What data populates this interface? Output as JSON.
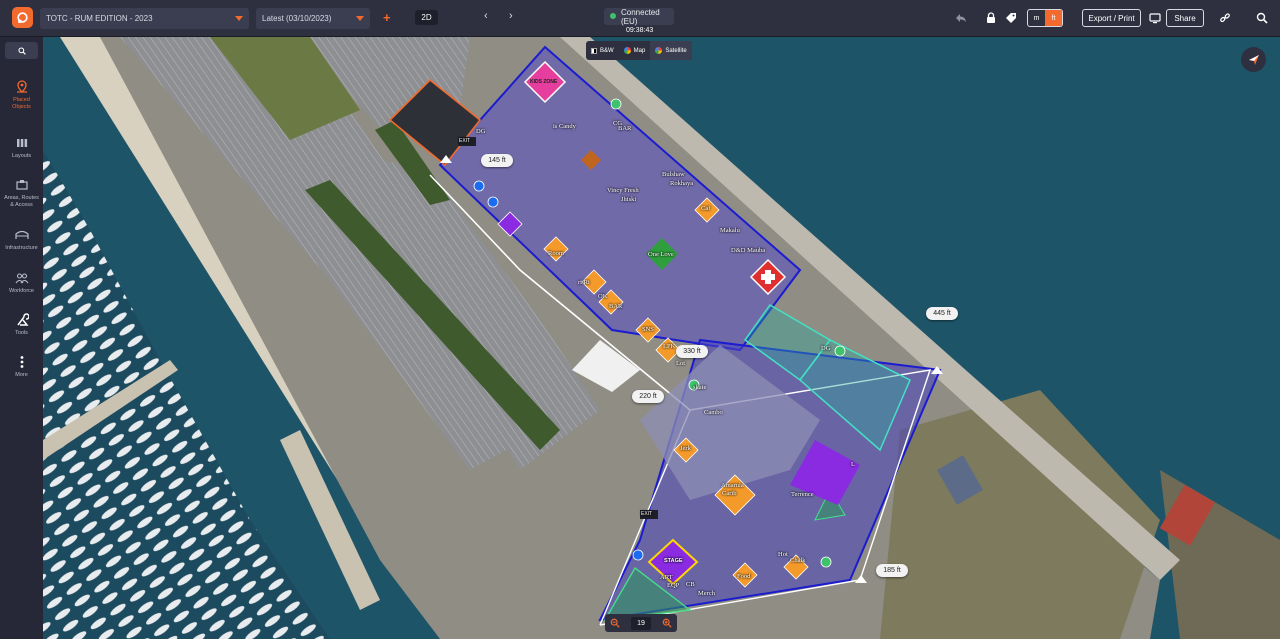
{
  "topbar": {
    "event_select": "TOTC - RUM EDITION - 2023",
    "version_select": "Latest (03/10/2023)",
    "view_mode": "2D",
    "connection_status": "Connected (EU)",
    "clock": "09:38:43",
    "unit_m": "m",
    "unit_ft": "ft",
    "unit_active": "ft",
    "export_label": "Export / Print",
    "share_label": "Share",
    "accent_color": "#f26a2e"
  },
  "sidebar": {
    "items": [
      {
        "label": "Placed\nObjects",
        "icon": "map-pin-icon",
        "active": true
      },
      {
        "label": "Layouts",
        "icon": "layouts-icon"
      },
      {
        "label": "Areas, Routes\n& Access",
        "icon": "areas-icon"
      },
      {
        "label": "Infrastructure",
        "icon": "infrastructure-icon"
      },
      {
        "label": "Workforce",
        "icon": "workforce-icon"
      },
      {
        "label": "Tools",
        "icon": "tools-icon"
      },
      {
        "label": "More",
        "icon": "more-icon"
      }
    ]
  },
  "map": {
    "layers": {
      "bw": "B&W",
      "map": "Map",
      "satellite": "Satellite"
    },
    "zoom_level": "19",
    "distances": [
      "145 ft",
      "445 ft",
      "330 ft",
      "220 ft",
      "185 ft"
    ],
    "labels": {
      "kids_zone": "KIDS ZONE",
      "stage": "STAGE",
      "exit1": "EXIT",
      "exit2": "EXIT",
      "cand": "is Candy",
      "bar": "BAR",
      "vincy": "Vincy Fresh",
      "jhiski": "Jhiski",
      "bulshaw": "Bulshaw",
      "rokhaya": "Rokhaya",
      "cafe": "Caf",
      "makalu": "Makalu",
      "dd": "D&D Mauba",
      "onelove": "One Love",
      "room": "Room",
      "ri": "ri Ri",
      "ok": "OK",
      "bar2": "BAR",
      "sns": "SNS",
      "lpk": "LPK",
      "lot": "Lot",
      "skate": "skate",
      "cambo": "Cambo",
      "jerk": "Jerk",
      "amarula": "Amarula",
      "carib": "Carib",
      "terrence": "Terrence",
      "art": "ART",
      "eqp": "EQP",
      "cb": "CB",
      "merch": "Merch",
      "food": "Food",
      "hot": "Hot",
      "chalk": "Chalk",
      "dg1": "DG",
      "dg2": "DG",
      "cg": "CG",
      "l": "L"
    }
  }
}
